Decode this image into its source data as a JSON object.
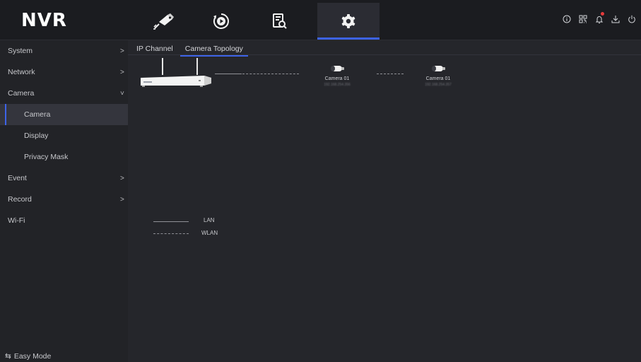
{
  "app": {
    "logo": "NVR"
  },
  "topnav": {
    "tabs": [
      {
        "icon": "camera-icon",
        "active": false
      },
      {
        "icon": "playback-icon",
        "active": false
      },
      {
        "icon": "file-search-icon",
        "active": false
      },
      {
        "icon": "settings-gear-icon",
        "active": true
      }
    ],
    "right_icons": [
      "info-icon",
      "qr-code-icon",
      "bell-icon",
      "download-icon",
      "power-icon"
    ]
  },
  "sidebar": {
    "items": [
      {
        "label": "System",
        "chevron": ">"
      },
      {
        "label": "Network",
        "chevron": ">"
      },
      {
        "label": "Camera",
        "chevron": "˅"
      },
      {
        "label": "Camera"
      },
      {
        "label": "Display"
      },
      {
        "label": "Privacy Mask"
      },
      {
        "label": "Event",
        "chevron": ">"
      },
      {
        "label": "Record",
        "chevron": ">"
      },
      {
        "label": "Wi-Fi"
      }
    ],
    "selected": "Camera",
    "footer": {
      "icon": "⇆",
      "label": "Easy Mode"
    }
  },
  "subtabs": [
    {
      "label": "IP Channel",
      "active": false
    },
    {
      "label": "Camera Topology",
      "active": true
    }
  ],
  "topology": {
    "cameras": [
      {
        "name": "Camera 01",
        "ip": "192.168.254.356"
      },
      {
        "name": "Camera 01",
        "ip": "192.168.254.357"
      }
    ],
    "legend": [
      {
        "style": "solid",
        "label": "LAN"
      },
      {
        "style": "dashed",
        "label": "WLAN"
      }
    ]
  },
  "colors": {
    "accent": "#3d63e8",
    "alert": "#e63b3b",
    "background": "#25262b",
    "sidebar": "#222327"
  }
}
